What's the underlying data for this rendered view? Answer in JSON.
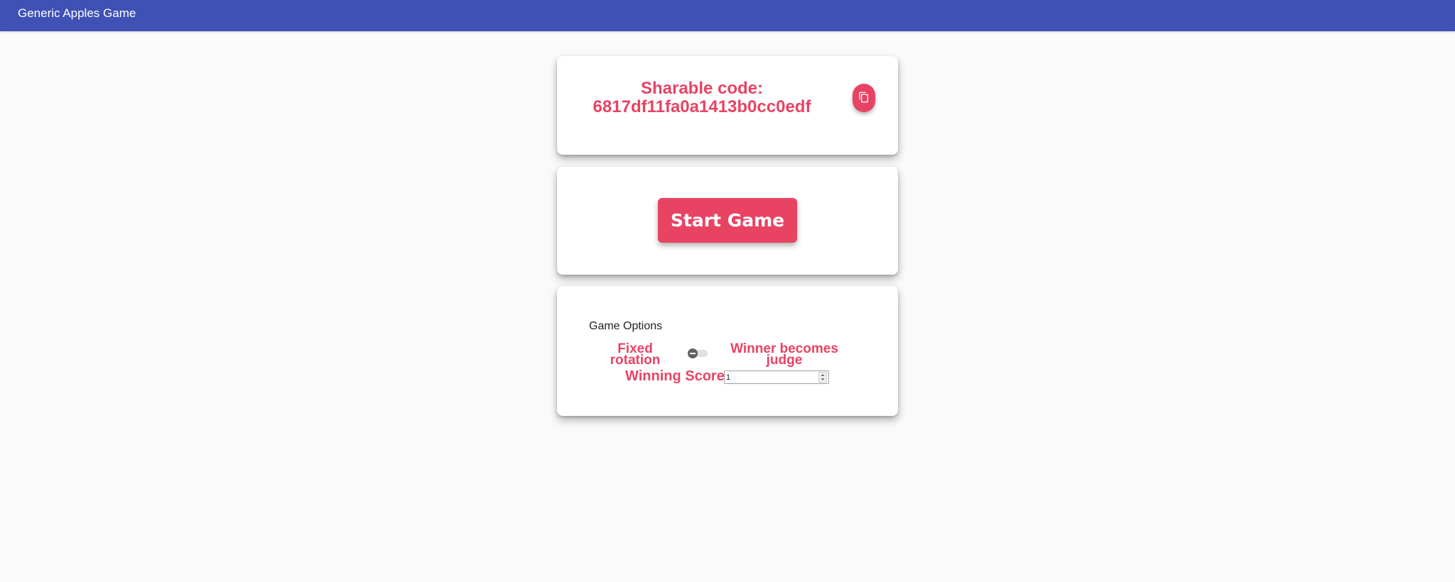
{
  "appbar": {
    "title": "Generic Apples Game"
  },
  "share_card": {
    "label": "Sharable code:",
    "code": "6817df11fa0a1413b0cc0edf",
    "copy_icon": "content-copy-icon"
  },
  "start_card": {
    "button_label": "Start Game"
  },
  "options_card": {
    "heading": "Game Options",
    "fixed_rotation_label_line1": "Fixed",
    "fixed_rotation_label_line2": "rotation",
    "winner_judge_label_line1": "Winner becomes",
    "winner_judge_label_line2": "judge",
    "toggle_state": "fixed-rotation",
    "winning_score_label": "Winning Score:",
    "winning_score_value": "1"
  },
  "colors": {
    "appbar": "#3f51b5",
    "accent": "#e84363",
    "background": "#fafafa",
    "card": "#ffffff"
  }
}
